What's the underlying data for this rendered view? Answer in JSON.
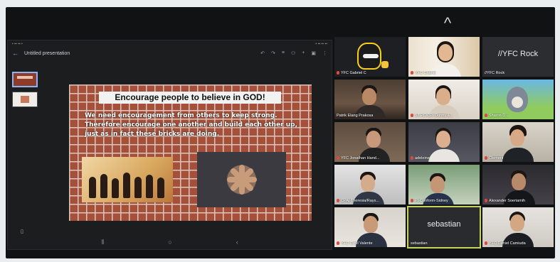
{
  "window": {
    "chevron": "^"
  },
  "share": {
    "status_left": "▪ ▪▪ ▪▪ ▪",
    "status_right": "▪ ▪▪ ▪▪ ▪▪",
    "app_title": "Untitled presentation",
    "slide_number": "▯",
    "slide": {
      "heading": "Encourage people to believe in GOD!",
      "body": "We need encouragement from others to keep strong. Therefore encourage one another and build each other up, just as in fact these bricks are doing."
    },
    "nav": {
      "recents": "⦀",
      "home": "○",
      "back": "‹"
    }
  },
  "participants": [
    {
      "name": "YFC Gabriel C",
      "muted": true
    },
    {
      "name": "YFC Chanel",
      "muted": true
    },
    {
      "name": "//YFC Rock",
      "muted": false,
      "display_name": "//YFC Rock"
    },
    {
      "name": "Patrik Elang Prakosa",
      "muted": false
    },
    {
      "name": "ST.PC/CP- Donny &...",
      "muted": true
    },
    {
      "name": "Sharon D...",
      "muted": true
    },
    {
      "name": "YFC Jonathan Hand...",
      "muted": true
    },
    {
      "name": "adeleine",
      "muted": true
    },
    {
      "name": "Clement",
      "muted": true
    },
    {
      "name": "CPAI Theresia/Rays...",
      "muted": true
    },
    {
      "name": "PI-Conform-Sidney",
      "muted": true
    },
    {
      "name": "Alexander Soeriamih",
      "muted": true
    },
    {
      "name": "YFC Cyrill Valente",
      "muted": true
    },
    {
      "name": "sebastian",
      "muted": false,
      "display_name": "sebastian"
    },
    {
      "name": "YFC Daniel Camiuda",
      "muted": true
    }
  ],
  "colors": {
    "frame_bg": "#111214",
    "active_speaker": "#c6d45a",
    "muted_mic": "#e0473e",
    "slides_accent": "#8ab4f8"
  }
}
